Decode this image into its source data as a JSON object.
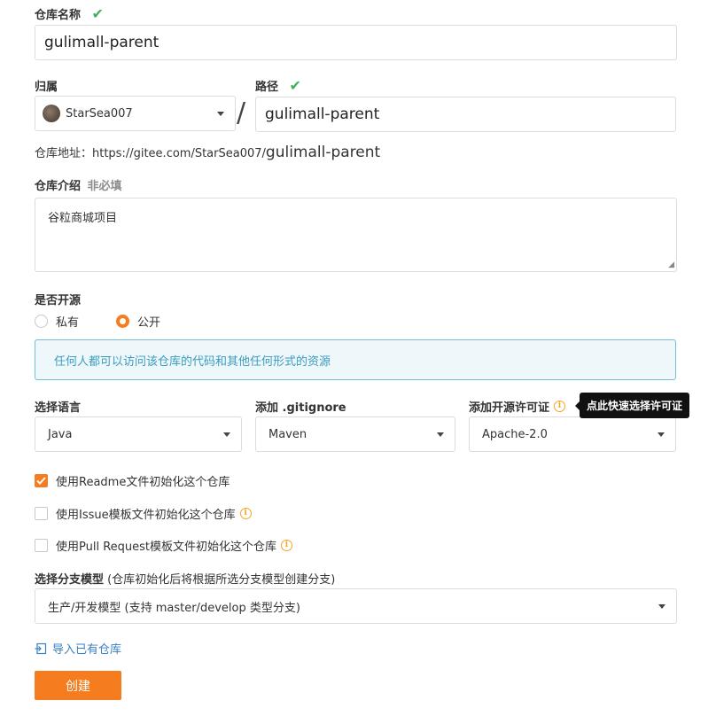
{
  "repo_name": {
    "label": "仓库名称",
    "value": "gulimall-parent"
  },
  "owner": {
    "label": "归属",
    "value": "StarSea007"
  },
  "path": {
    "label": "路径",
    "value": "gulimall-parent",
    "separator": "/"
  },
  "repo_url": {
    "prefix": "仓库地址：https://gitee.com/StarSea007/",
    "suffix": "gulimall-parent"
  },
  "description": {
    "label": "仓库介绍",
    "optional": "非必填",
    "value": "谷粒商城项目"
  },
  "visibility": {
    "label": "是否开源",
    "options": [
      "私有",
      "公开"
    ],
    "selected": "公开",
    "notice": "任何人都可以访问该仓库的代码和其他任何形式的资源"
  },
  "language": {
    "label": "选择语言",
    "value": "Java"
  },
  "gitignore": {
    "label": "添加 .gitignore",
    "value": "Maven"
  },
  "license": {
    "label": "添加开源许可证",
    "value": "Apache-2.0",
    "tooltip": "点此快速选择许可证"
  },
  "init_options": [
    {
      "label": "使用Readme文件初始化这个仓库",
      "checked": true,
      "info": false
    },
    {
      "label": "使用Issue模板文件初始化这个仓库",
      "checked": false,
      "info": true
    },
    {
      "label": "使用Pull Request模板文件初始化这个仓库",
      "checked": false,
      "info": true
    }
  ],
  "branch_model": {
    "label": "选择分支模型",
    "hint": "(仓库初始化后将根据所选分支模型创建分支)",
    "value": "生产/开发模型 (支持 master/develop 类型分支)"
  },
  "import_link": "导入已有仓库",
  "create_button": "创建",
  "colors": {
    "accent": "#f57c1f",
    "success": "#3fb15c",
    "info_bg": "#eef7fa",
    "info_border": "#6fc2d6",
    "info_text": "#3a9cc0"
  }
}
